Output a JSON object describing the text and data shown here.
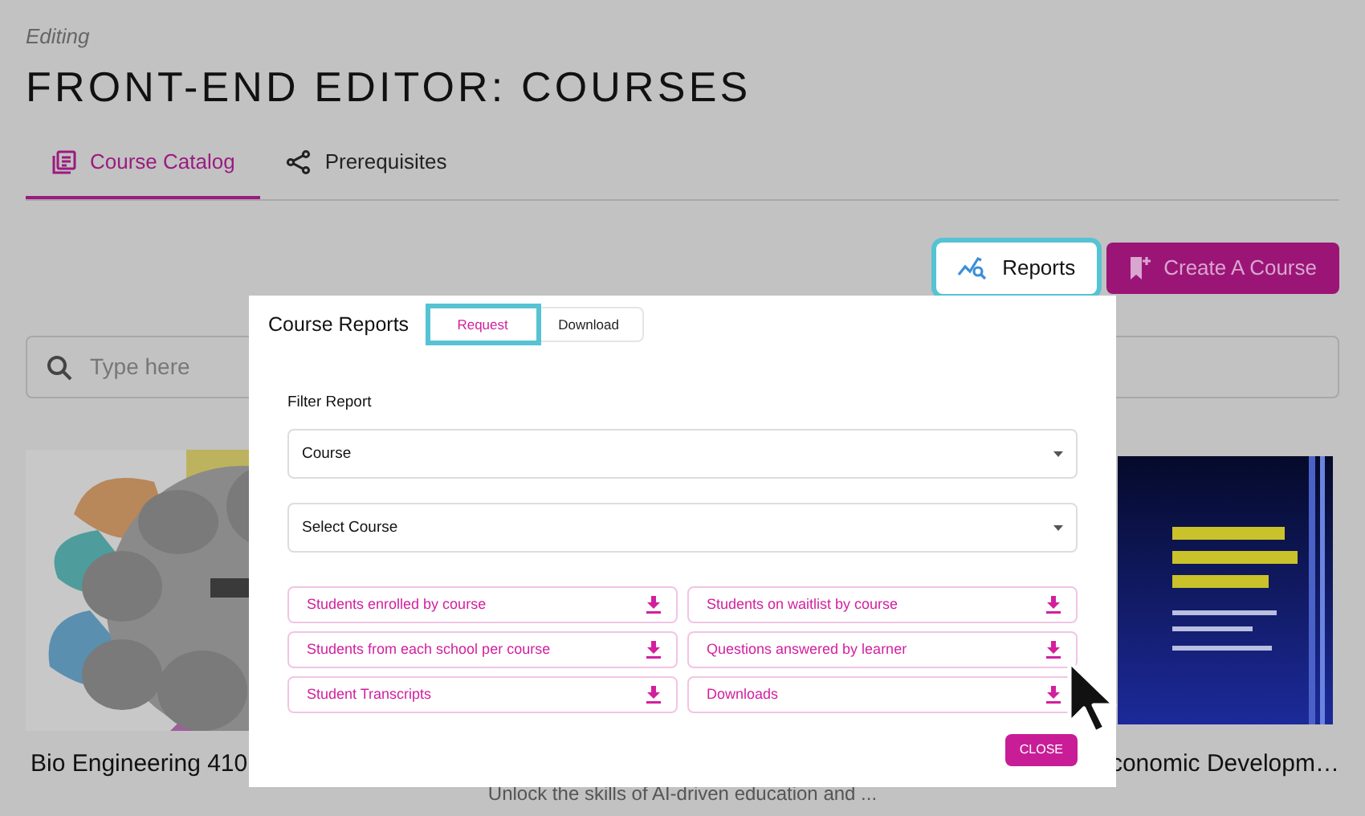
{
  "header": {
    "eyebrow": "Editing",
    "title": "FRONT-END EDITOR: COURSES"
  },
  "tabs": [
    {
      "label": "Course Catalog",
      "selected": true,
      "kind": "catalog"
    },
    {
      "label": "Prerequisites",
      "selected": false,
      "kind": "share"
    }
  ],
  "actions": [
    {
      "label": "Reports",
      "kind": "reports",
      "highlighted": true
    },
    {
      "label": "Create A Course",
      "kind": "create",
      "highlighted": false
    }
  ],
  "search": {
    "placeholder": "Type here"
  },
  "courses": [
    {
      "title": "Bio Engineering 410",
      "kind": "picture"
    },
    {
      "description": "Unlock the skills of AI-driven education and ...",
      "kind": "picture"
    },
    {
      "title": "conomic Developm…",
      "kind": "picture"
    }
  ],
  "dialog": {
    "title": "Course Reports",
    "tabs": [
      {
        "label": "Request",
        "selected": true,
        "highlighted": true
      },
      {
        "label": "Download",
        "selected": false,
        "highlighted": false
      }
    ],
    "filter_label": "Filter Report",
    "selects": [
      {
        "value": "Course"
      },
      {
        "value": "Select Course"
      }
    ],
    "reports": [
      {
        "label": "Students enrolled by course"
      },
      {
        "label": "Students on waitlist by course"
      },
      {
        "label": "Students from each school per course"
      },
      {
        "label": "Questions answered by learner"
      },
      {
        "label": "Student Transcripts"
      },
      {
        "label": "Downloads"
      }
    ],
    "close": "CLOSE"
  }
}
